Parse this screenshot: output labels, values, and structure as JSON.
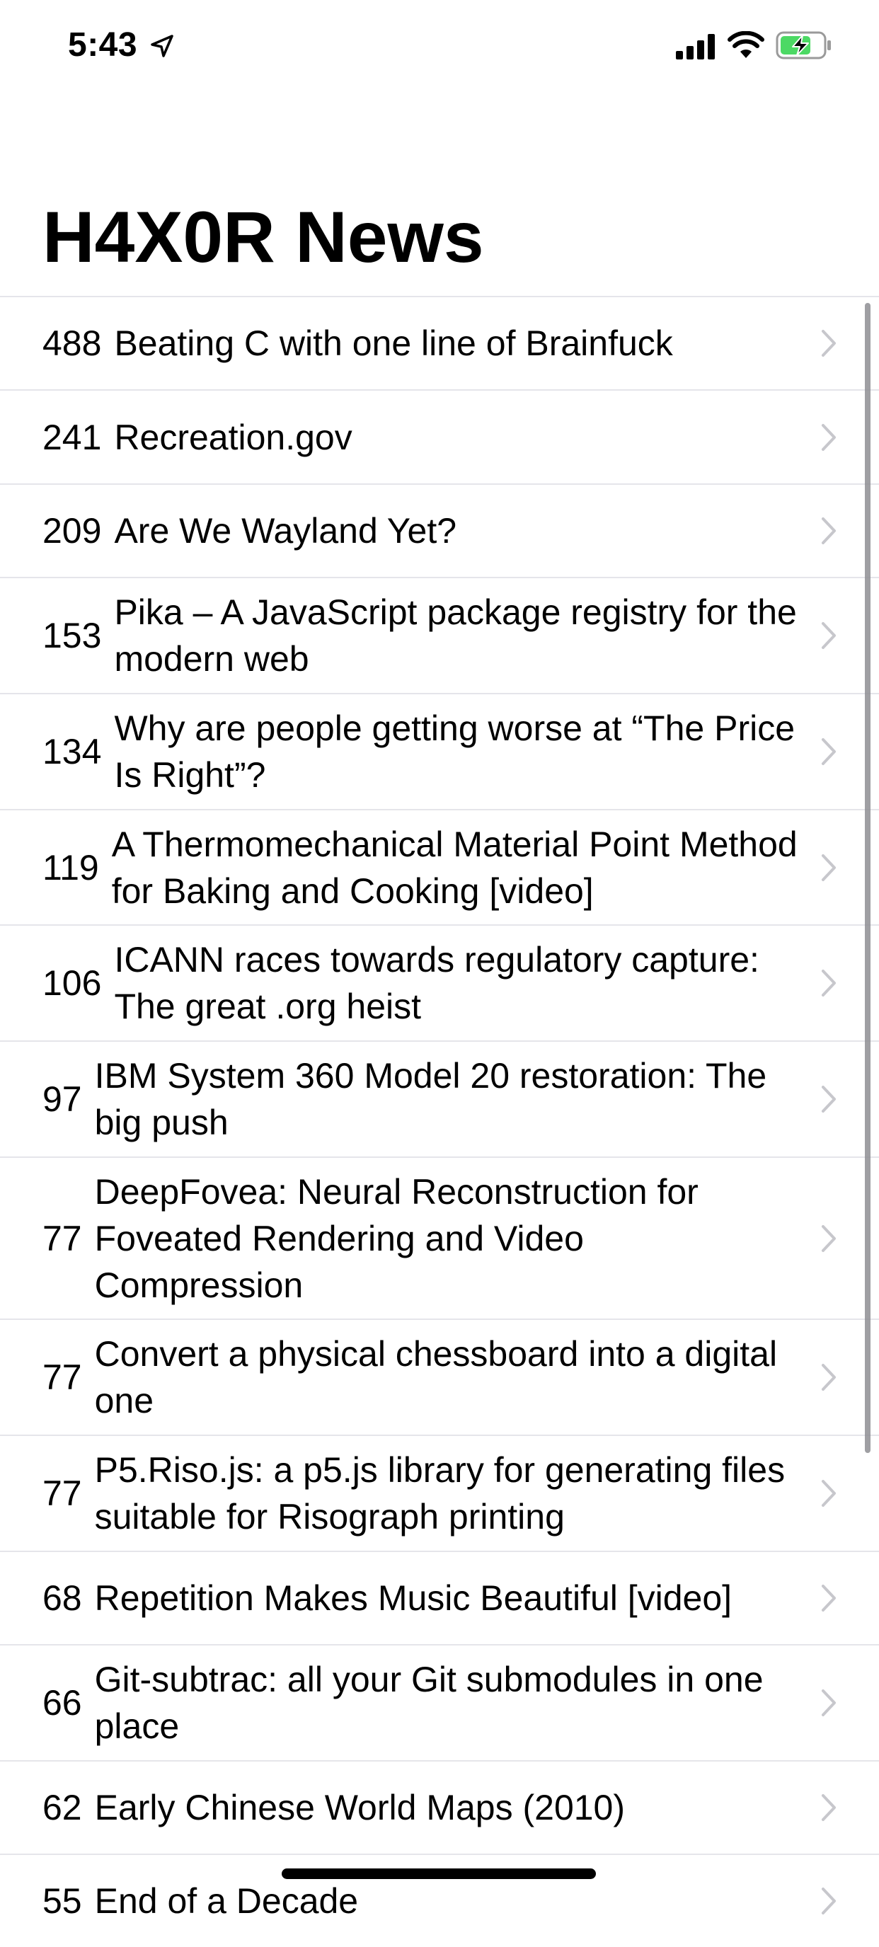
{
  "status_bar": {
    "time": "5:43",
    "icons": [
      "location-arrow-icon",
      "cellular-signal-icon",
      "wifi-icon",
      "battery-charging-icon"
    ],
    "battery_color": "#4cd964"
  },
  "header": {
    "title": "H4X0R News"
  },
  "stories": [
    {
      "points": "488",
      "title": "Beating C with one line of Brainfuck"
    },
    {
      "points": "241",
      "title": "Recreation.gov"
    },
    {
      "points": "209",
      "title": "Are We Wayland Yet?"
    },
    {
      "points": "153",
      "title": "Pika – A JavaScript package registry for the modern web"
    },
    {
      "points": "134",
      "title": "Why are people getting worse at “The Price Is Right”?"
    },
    {
      "points": "119",
      "title": "A Thermomechanical Material Point Method for Baking and Cooking [video]"
    },
    {
      "points": "106",
      "title": "ICANN races towards regulatory capture: The great .org heist"
    },
    {
      "points": "97",
      "title": "IBM System 360 Model 20 restoration: The big push"
    },
    {
      "points": "77",
      "title": "DeepFovea: Neural Reconstruction for Foveated Rendering and Video Compression"
    },
    {
      "points": "77",
      "title": "Convert a physical chessboard into a digital one"
    },
    {
      "points": "77",
      "title": "P5.Riso.js: a p5.js library for generating files suitable for Risograph printing"
    },
    {
      "points": "68",
      "title": "Repetition Makes Music Beautiful [video]"
    },
    {
      "points": "66",
      "title": "Git-subtrac: all your Git submodules in one place"
    },
    {
      "points": "62",
      "title": "Early Chinese World Maps (2010)"
    },
    {
      "points": "55",
      "title": "End of a Decade"
    }
  ],
  "colors": {
    "separator": "#e5e5ea",
    "chevron": "#c7c7cc",
    "scroll_indicator": "#8e8e93"
  }
}
